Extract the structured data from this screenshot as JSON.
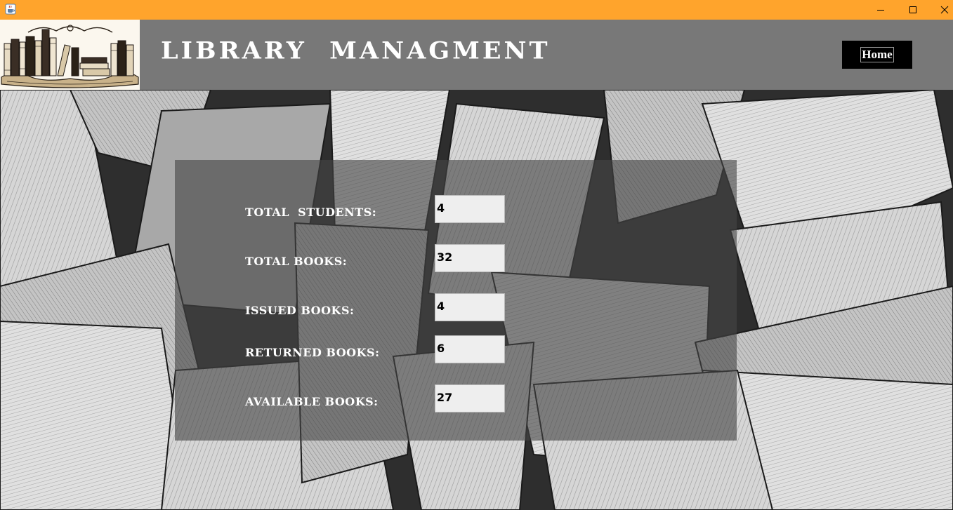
{
  "window": {
    "icon": "java-cup-icon",
    "accent_color": "#ffa42c",
    "controls": [
      "minimize",
      "maximize",
      "close"
    ]
  },
  "header": {
    "logo": "bookshelf-logo",
    "title": "LIBRARY  MANAGMENT",
    "home_label": "Home",
    "background_color": "#787878"
  },
  "stats": {
    "total_students": {
      "label": "TOTAL  STUDENTS:",
      "value": "4"
    },
    "total_books": {
      "label": "TOTAL BOOKS:",
      "value": "32"
    },
    "issued_books": {
      "label": "ISSUED BOOKS:",
      "value": "4"
    },
    "returned_books": {
      "label": "RETURNED BOOKS:",
      "value": "6"
    },
    "available_books": {
      "label": "AVAILABLE BOOKS:",
      "value": "27"
    }
  }
}
